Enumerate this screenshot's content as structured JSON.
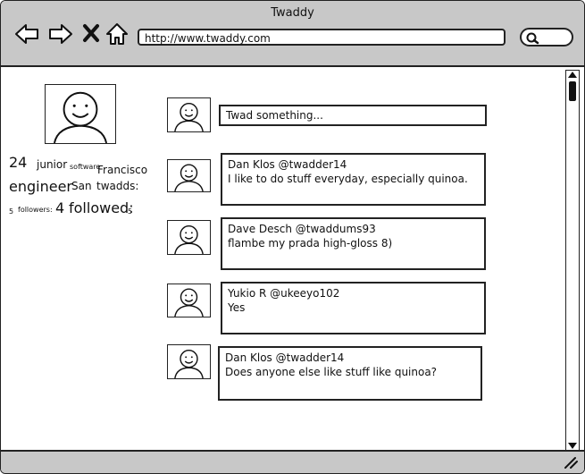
{
  "window": {
    "title": "Twaddy"
  },
  "toolbar": {
    "url": "http://www.twaddy.com"
  },
  "profile": {
    "num1": "24",
    "word_junior": "junior",
    "word_software": "software",
    "word_francisco": "Francisco",
    "word_engineer": "engineer",
    "word_san": "San",
    "word_twadds": "twadds:",
    "small_5a": "5",
    "word_followers": "followers:",
    "num_followed": "4",
    "word_followed": "followed:",
    "small_5b": "5"
  },
  "compose": {
    "placeholder": "Twad something..."
  },
  "tweets": [
    {
      "author": "Dan Klos @twadder14",
      "text": "I like to do stuff everyday, especially quinoa."
    },
    {
      "author": "Dave Desch @twaddums93",
      "text": "flambe my prada high-gloss 8)"
    },
    {
      "author": "Yukio R @ukeeyo102",
      "text": "Yes"
    },
    {
      "author": "Dan Klos @twadder14",
      "text": "Does anyone else like stuff like quinoa?"
    }
  ]
}
